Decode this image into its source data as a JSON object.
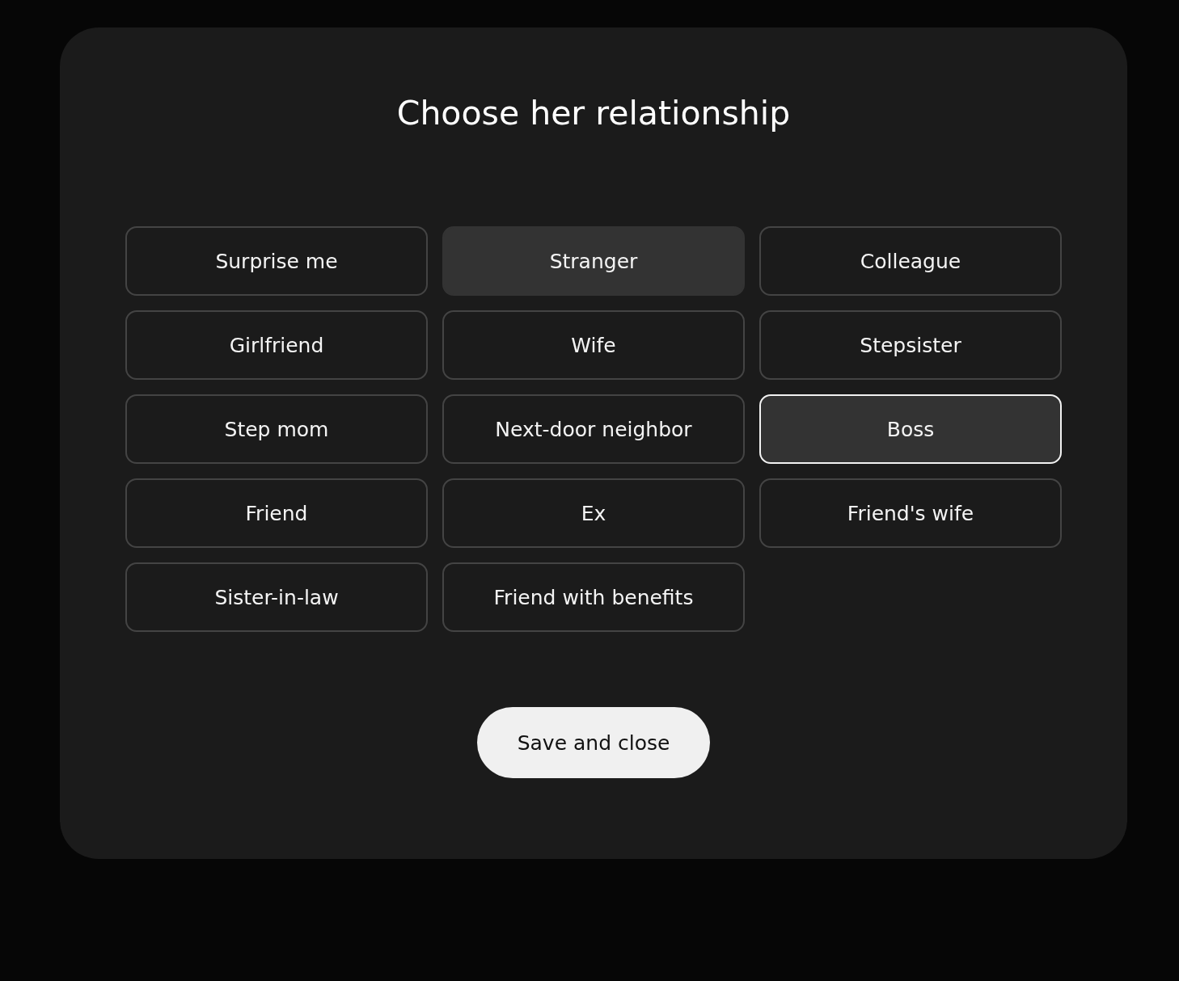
{
  "dialog": {
    "title": "Choose her relationship"
  },
  "options": [
    {
      "label": "Surprise me",
      "selected": false,
      "hovered": false
    },
    {
      "label": "Stranger",
      "selected": false,
      "hovered": true
    },
    {
      "label": "Colleague",
      "selected": false,
      "hovered": false
    },
    {
      "label": "Girlfriend",
      "selected": false,
      "hovered": false
    },
    {
      "label": "Wife",
      "selected": false,
      "hovered": false
    },
    {
      "label": "Stepsister",
      "selected": false,
      "hovered": false
    },
    {
      "label": "Step mom",
      "selected": false,
      "hovered": false
    },
    {
      "label": "Next-door neighbor",
      "selected": false,
      "hovered": false
    },
    {
      "label": "Boss",
      "selected": true,
      "hovered": false
    },
    {
      "label": "Friend",
      "selected": false,
      "hovered": false
    },
    {
      "label": "Ex",
      "selected": false,
      "hovered": false
    },
    {
      "label": "Friend's wife",
      "selected": false,
      "hovered": false
    },
    {
      "label": "Sister-in-law",
      "selected": false,
      "hovered": false
    },
    {
      "label": "Friend with benefits",
      "selected": false,
      "hovered": false
    }
  ],
  "save_button": {
    "label": "Save and close"
  }
}
